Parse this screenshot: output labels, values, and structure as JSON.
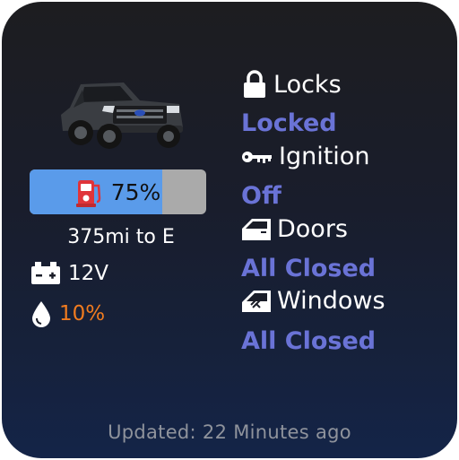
{
  "fuel": {
    "percent_label": "75%",
    "level": 0.75,
    "range_label": "375mi to E"
  },
  "battery": {
    "value": "12V",
    "icon": "battery-icon"
  },
  "oil": {
    "value": "10%",
    "icon": "oil-drop-icon",
    "color": "#f07b1f"
  },
  "status": {
    "locks": {
      "label": "Locks",
      "value": "Locked",
      "icon": "lock-icon"
    },
    "ignition": {
      "label": "Ignition",
      "value": "Off",
      "icon": "key-icon"
    },
    "doors": {
      "label": "Doors",
      "value": "All Closed",
      "icon": "door-icon"
    },
    "windows": {
      "label": "Windows",
      "value": "All Closed",
      "icon": "window-icon"
    }
  },
  "colors": {
    "accent": "#6a73d6",
    "fuel_fill": "#5a9bea",
    "warning": "#f07b1f"
  },
  "footer": {
    "updated": "Updated: 22 Minutes ago"
  }
}
